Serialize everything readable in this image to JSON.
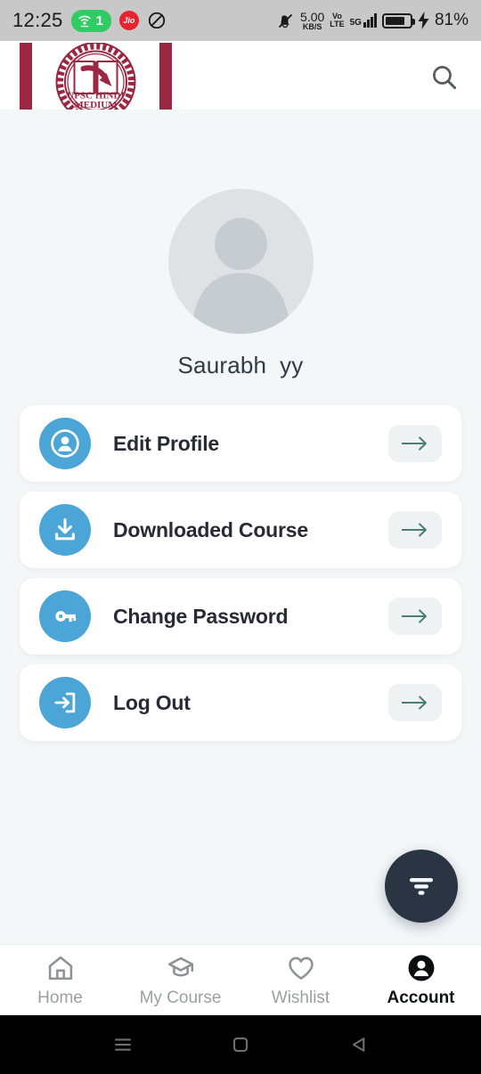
{
  "status_bar": {
    "time": "12:25",
    "hotspot_count": "1",
    "carrier_badge": "Jio",
    "dnd_icon": "do-not-disturb-icon",
    "silent_icon": "bell-muted-icon",
    "net_speed_value": "5.00",
    "net_speed_unit": "KB/S",
    "volte_line1": "Vo",
    "volte_line2": "LTE",
    "network_type": "5G",
    "battery_percent": "81%",
    "battery_level": 81,
    "charging": true
  },
  "app_bar": {
    "logo_line1": "UPSC HINDI",
    "logo_line2": "MEDIUM",
    "logo_alt": "UPSC Hindi Medium logo",
    "search_icon": "search-icon"
  },
  "profile": {
    "avatar_icon": "default-user-avatar",
    "name": "Saurabh  yy"
  },
  "menu": {
    "items": [
      {
        "label": "Edit Profile",
        "icon": "user-circle-icon",
        "arrow": "arrow-right-icon"
      },
      {
        "label": "Downloaded Course",
        "icon": "download-icon",
        "arrow": "arrow-right-icon"
      },
      {
        "label": "Change Password",
        "icon": "key-icon",
        "arrow": "arrow-right-icon"
      },
      {
        "label": "Log Out",
        "icon": "logout-icon",
        "arrow": "arrow-right-icon"
      }
    ]
  },
  "fab": {
    "icon": "filter-icon",
    "label": "Filter"
  },
  "bottom_nav": {
    "items": [
      {
        "label": "Home",
        "icon": "home-icon",
        "active": false
      },
      {
        "label": "My Course",
        "icon": "graduation-cap-icon",
        "active": false
      },
      {
        "label": "Wishlist",
        "icon": "heart-icon",
        "active": false
      },
      {
        "label": "Account",
        "icon": "account-filled-icon",
        "active": true
      }
    ]
  },
  "android_nav": {
    "recents": "recents-icon",
    "home": "home-square-icon",
    "back": "back-triangle-icon"
  },
  "colors": {
    "accent_blue": "#4ba5d6",
    "fab_dark": "#2b3442",
    "arrow_teal": "#4d7e71",
    "logo_maroon": "#9b2743",
    "background": "#f3f7f8",
    "card_white": "#ffffff",
    "status_bar_gray": "#c8c8c8",
    "hotspot_green": "#2ecc62",
    "jio_red": "#e8222e"
  }
}
